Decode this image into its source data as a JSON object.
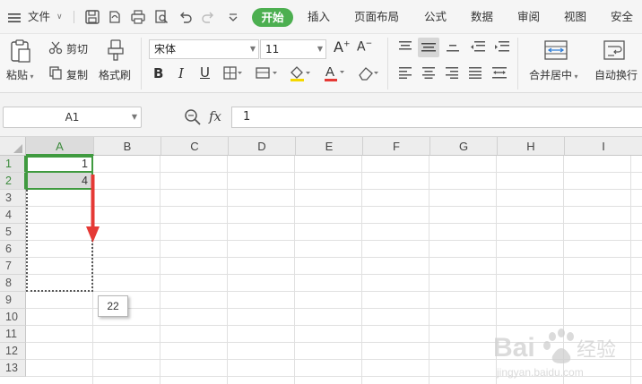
{
  "menubar": {
    "file_label": "文件",
    "tabs": [
      "开始",
      "插入",
      "页面布局",
      "公式",
      "数据",
      "审阅",
      "视图",
      "安全"
    ],
    "active_tab": "开始"
  },
  "ribbon": {
    "paste_label": "粘贴",
    "cut_label": "剪切",
    "copy_label": "复制",
    "format_painter_label": "格式刷",
    "font_name": "宋体",
    "font_size": "11",
    "merge_label": "合并居中",
    "wrap_label": "自动换行"
  },
  "formula_bar": {
    "name_box": "A1",
    "fx_label": "fx",
    "formula_value": "1"
  },
  "sheet": {
    "columns": [
      "A",
      "B",
      "C",
      "D",
      "E",
      "F",
      "G",
      "H",
      "I"
    ],
    "rows": [
      "1",
      "2",
      "3",
      "4",
      "5",
      "6",
      "7",
      "8",
      "9",
      "10",
      "11",
      "12",
      "13"
    ],
    "cell_a1": "1",
    "cell_a2": "4",
    "selected_column": "A",
    "fill_tooltip": "22"
  },
  "colors": {
    "accent": "#4caf50",
    "selection": "#3f9a3f",
    "arrow": "#e53935"
  },
  "watermark": {
    "text_main": "Bai",
    "text_cn": "经验",
    "text_url": "jingyan.baidu.com"
  }
}
